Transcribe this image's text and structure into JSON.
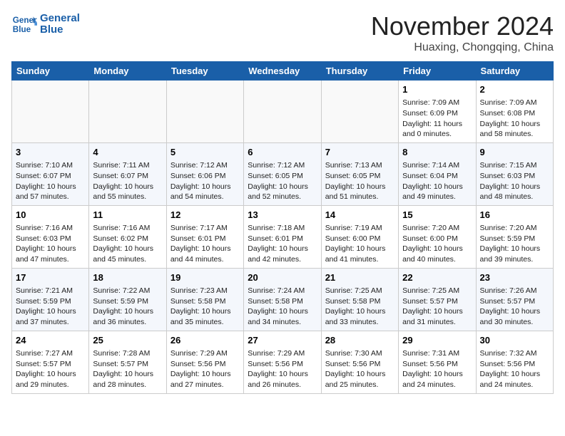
{
  "header": {
    "logo_line1": "General",
    "logo_line2": "Blue",
    "month": "November 2024",
    "location": "Huaxing, Chongqing, China"
  },
  "weekdays": [
    "Sunday",
    "Monday",
    "Tuesday",
    "Wednesday",
    "Thursday",
    "Friday",
    "Saturday"
  ],
  "weeks": [
    [
      {
        "day": "",
        "info": ""
      },
      {
        "day": "",
        "info": ""
      },
      {
        "day": "",
        "info": ""
      },
      {
        "day": "",
        "info": ""
      },
      {
        "day": "",
        "info": ""
      },
      {
        "day": "1",
        "info": "Sunrise: 7:09 AM\nSunset: 6:09 PM\nDaylight: 11 hours and 0 minutes."
      },
      {
        "day": "2",
        "info": "Sunrise: 7:09 AM\nSunset: 6:08 PM\nDaylight: 10 hours and 58 minutes."
      }
    ],
    [
      {
        "day": "3",
        "info": "Sunrise: 7:10 AM\nSunset: 6:07 PM\nDaylight: 10 hours and 57 minutes."
      },
      {
        "day": "4",
        "info": "Sunrise: 7:11 AM\nSunset: 6:07 PM\nDaylight: 10 hours and 55 minutes."
      },
      {
        "day": "5",
        "info": "Sunrise: 7:12 AM\nSunset: 6:06 PM\nDaylight: 10 hours and 54 minutes."
      },
      {
        "day": "6",
        "info": "Sunrise: 7:12 AM\nSunset: 6:05 PM\nDaylight: 10 hours and 52 minutes."
      },
      {
        "day": "7",
        "info": "Sunrise: 7:13 AM\nSunset: 6:05 PM\nDaylight: 10 hours and 51 minutes."
      },
      {
        "day": "8",
        "info": "Sunrise: 7:14 AM\nSunset: 6:04 PM\nDaylight: 10 hours and 49 minutes."
      },
      {
        "day": "9",
        "info": "Sunrise: 7:15 AM\nSunset: 6:03 PM\nDaylight: 10 hours and 48 minutes."
      }
    ],
    [
      {
        "day": "10",
        "info": "Sunrise: 7:16 AM\nSunset: 6:03 PM\nDaylight: 10 hours and 47 minutes."
      },
      {
        "day": "11",
        "info": "Sunrise: 7:16 AM\nSunset: 6:02 PM\nDaylight: 10 hours and 45 minutes."
      },
      {
        "day": "12",
        "info": "Sunrise: 7:17 AM\nSunset: 6:01 PM\nDaylight: 10 hours and 44 minutes."
      },
      {
        "day": "13",
        "info": "Sunrise: 7:18 AM\nSunset: 6:01 PM\nDaylight: 10 hours and 42 minutes."
      },
      {
        "day": "14",
        "info": "Sunrise: 7:19 AM\nSunset: 6:00 PM\nDaylight: 10 hours and 41 minutes."
      },
      {
        "day": "15",
        "info": "Sunrise: 7:20 AM\nSunset: 6:00 PM\nDaylight: 10 hours and 40 minutes."
      },
      {
        "day": "16",
        "info": "Sunrise: 7:20 AM\nSunset: 5:59 PM\nDaylight: 10 hours and 39 minutes."
      }
    ],
    [
      {
        "day": "17",
        "info": "Sunrise: 7:21 AM\nSunset: 5:59 PM\nDaylight: 10 hours and 37 minutes."
      },
      {
        "day": "18",
        "info": "Sunrise: 7:22 AM\nSunset: 5:59 PM\nDaylight: 10 hours and 36 minutes."
      },
      {
        "day": "19",
        "info": "Sunrise: 7:23 AM\nSunset: 5:58 PM\nDaylight: 10 hours and 35 minutes."
      },
      {
        "day": "20",
        "info": "Sunrise: 7:24 AM\nSunset: 5:58 PM\nDaylight: 10 hours and 34 minutes."
      },
      {
        "day": "21",
        "info": "Sunrise: 7:25 AM\nSunset: 5:58 PM\nDaylight: 10 hours and 33 minutes."
      },
      {
        "day": "22",
        "info": "Sunrise: 7:25 AM\nSunset: 5:57 PM\nDaylight: 10 hours and 31 minutes."
      },
      {
        "day": "23",
        "info": "Sunrise: 7:26 AM\nSunset: 5:57 PM\nDaylight: 10 hours and 30 minutes."
      }
    ],
    [
      {
        "day": "24",
        "info": "Sunrise: 7:27 AM\nSunset: 5:57 PM\nDaylight: 10 hours and 29 minutes."
      },
      {
        "day": "25",
        "info": "Sunrise: 7:28 AM\nSunset: 5:57 PM\nDaylight: 10 hours and 28 minutes."
      },
      {
        "day": "26",
        "info": "Sunrise: 7:29 AM\nSunset: 5:56 PM\nDaylight: 10 hours and 27 minutes."
      },
      {
        "day": "27",
        "info": "Sunrise: 7:29 AM\nSunset: 5:56 PM\nDaylight: 10 hours and 26 minutes."
      },
      {
        "day": "28",
        "info": "Sunrise: 7:30 AM\nSunset: 5:56 PM\nDaylight: 10 hours and 25 minutes."
      },
      {
        "day": "29",
        "info": "Sunrise: 7:31 AM\nSunset: 5:56 PM\nDaylight: 10 hours and 24 minutes."
      },
      {
        "day": "30",
        "info": "Sunrise: 7:32 AM\nSunset: 5:56 PM\nDaylight: 10 hours and 24 minutes."
      }
    ]
  ]
}
